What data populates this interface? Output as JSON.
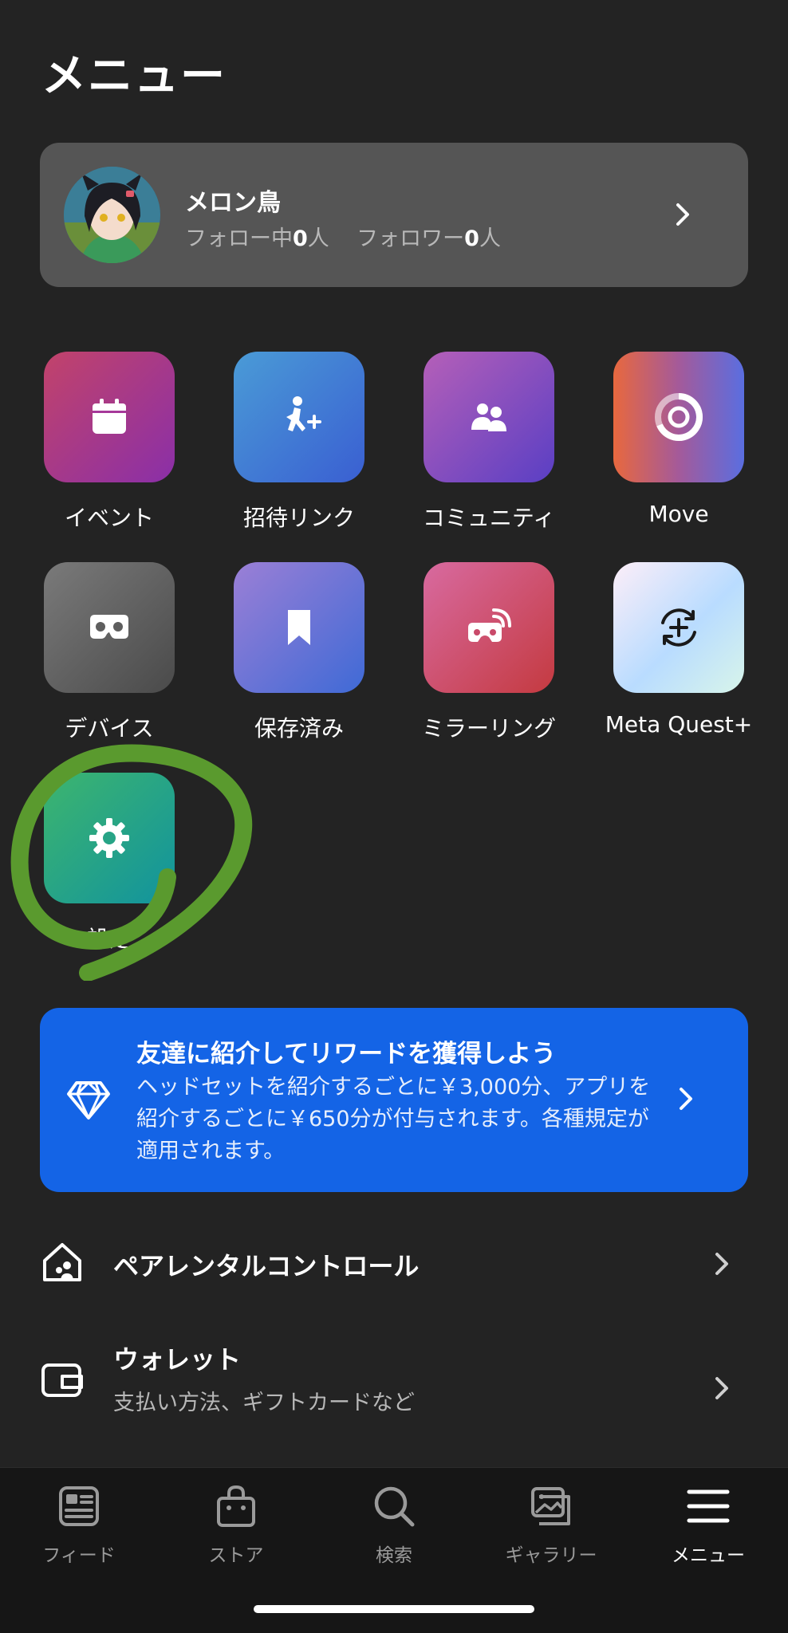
{
  "header": {
    "title": "メニュー"
  },
  "profile": {
    "name": "メロン鳥",
    "following_label": "フォロー中",
    "following_count": "0",
    "following_unit": "人",
    "followers_label": "フォロワー",
    "followers_count": "0",
    "followers_unit": "人"
  },
  "grid": {
    "items": [
      {
        "label": "イベント",
        "icon": "calendar-icon"
      },
      {
        "label": "招待リンク",
        "icon": "invite-person-icon"
      },
      {
        "label": "コミュニティ",
        "icon": "people-icon"
      },
      {
        "label": "Move",
        "icon": "move-ring-icon"
      },
      {
        "label": "デバイス",
        "icon": "headset-icon"
      },
      {
        "label": "保存済み",
        "icon": "bookmark-icon"
      },
      {
        "label": "ミラーリング",
        "icon": "casting-icon"
      },
      {
        "label": "Meta Quest+",
        "icon": "quest-plus-icon"
      },
      {
        "label": "設定",
        "icon": "gear-icon"
      }
    ]
  },
  "referral": {
    "title": "友達に紹介してリワードを獲得しよう",
    "body": "ヘッドセットを紹介するごとに￥3,000分、アプリを紹介するごとに￥650分が付与されます。各種規定が適用されます。",
    "icon": "diamond-icon"
  },
  "list": {
    "parental": {
      "title": "ペアレンタルコントロール",
      "icon": "home-family-icon"
    },
    "wallet": {
      "title": "ウォレット",
      "subtitle": "支払い方法、ギフトカードなど",
      "icon": "wallet-icon"
    }
  },
  "tabbar": {
    "tabs": [
      {
        "label": "フィード",
        "icon": "feed-icon"
      },
      {
        "label": "ストア",
        "icon": "store-bag-icon"
      },
      {
        "label": "検索",
        "icon": "search-icon"
      },
      {
        "label": "ギャラリー",
        "icon": "gallery-icon"
      },
      {
        "label": "メニュー",
        "icon": "menu-icon",
        "active": true
      }
    ]
  },
  "colors": {
    "background": "#232323",
    "card": "#555555",
    "referral": "#1464e6",
    "annotation_stroke": "#5a9a2e"
  }
}
